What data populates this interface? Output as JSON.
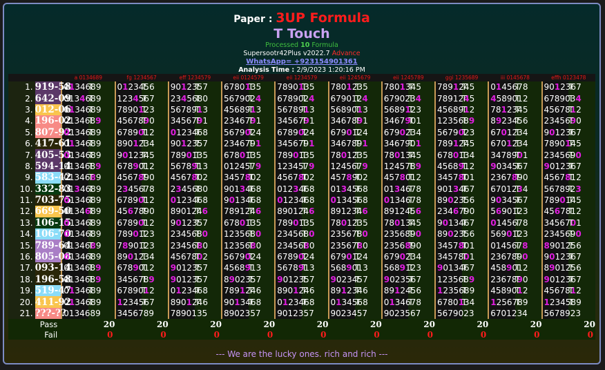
{
  "header": {
    "paper_label": "Paper :",
    "formula_name": "3UP Formula",
    "subtitle": "T Touch",
    "processed_prefix": "Processed",
    "processed_count": "10",
    "processed_suffix": "Formula",
    "version": "Supersootr42Plus v2022.7",
    "edition": "Advance",
    "whatsapp": "WhatsApp= +923154901361",
    "analysis_label": "Analysis Time :",
    "analysis_time": "2/9/2023 1:20:16 PM"
  },
  "colors": {
    "hit": "#e01ee0",
    "purple": "#5b3868",
    "gold": "#f9c54e",
    "pink": "#f78a86",
    "dark": "#2a2608",
    "lightblue": "#8adcf8",
    "darkgreen": "#083a10",
    "lavender": "#a97ec6"
  },
  "columns": [
    "a 0134689",
    "fg 1234567",
    "eff 1234579",
    "eii 0124579",
    "eii 1234579",
    "eii 1245679",
    "eii 1245789",
    "ggi 1235689",
    "iii 0145678",
    "effh 0123478"
  ],
  "status_mark": "T",
  "rows": [
    {
      "n": "1.",
      "result": "919-58",
      "color": "purple",
      "hit": "1",
      "cells": [
        "0134689",
        "0123456",
        "9012357",
        "6780135",
        "7890135",
        "7801235",
        "7801345",
        "7891245",
        "0145678",
        "9012367"
      ]
    },
    {
      "n": "2.",
      "result": "642-09",
      "color": "purple",
      "hit": "4",
      "cells": [
        "0134689",
        "1234567",
        "2345680",
        "5679024",
        "6789024",
        "6790124",
        "6790234",
        "7891245",
        "4589012",
        "6789034"
      ]
    },
    {
      "n": "3.",
      "result": "012-06",
      "color": "gold",
      "hit": "1",
      "cells": [
        "0134689",
        "7890123",
        "5678913",
        "4568913",
        "5678913",
        "5689013",
        "5689123",
        "4568912",
        "7812345",
        "4567812"
      ]
    },
    {
      "n": "4.",
      "result": "196-02",
      "color": "pink",
      "hit": "9",
      "cells": [
        "0134689",
        "4567890",
        "3456791",
        "2346791",
        "3456791",
        "3467891",
        "3467901",
        "1235689",
        "8923456",
        "2345690"
      ]
    },
    {
      "n": "5.",
      "result": "807-92",
      "color": "pink",
      "hit": "0",
      "cells": [
        "0134689",
        "6789012",
        "0123468",
        "5679024",
        "6789024",
        "6790124",
        "6790234",
        "5679023",
        "6701234",
        "9012367"
      ]
    },
    {
      "n": "6.",
      "result": "417-61",
      "color": "dark",
      "hit": "1",
      "cells": [
        "0134689",
        "8901234",
        "9012357",
        "2346791",
        "3456791",
        "3467891",
        "3467901",
        "7891245",
        "6701234",
        "7890145"
      ]
    },
    {
      "n": "7.",
      "result": "405-53",
      "color": "purple",
      "hit": "0",
      "cells": [
        "0134689",
        "9012345",
        "7890135",
        "6780135",
        "7890135",
        "7801235",
        "7801345",
        "6780134",
        "3478901",
        "2345690"
      ]
    },
    {
      "n": "8.",
      "result": "594-14",
      "color": "purple",
      "hit": "9",
      "cells": [
        "0134689",
        "6789012",
        "5678913",
        "0124579",
        "1234579",
        "1245679",
        "1245789",
        "4568912",
        "9034567",
        "9012367"
      ]
    },
    {
      "n": "9.",
      "result": "583-42",
      "color": "lightblue",
      "hit": "8",
      "cells": [
        "0134689",
        "4567890",
        "4567802",
        "3457802",
        "4567802",
        "4578902",
        "4578012",
        "3457801",
        "2367890",
        "4567812"
      ]
    },
    {
      "n": "10.",
      "result": "332-83",
      "color": "darkgreen",
      "hit": "3",
      "cells": [
        "0134689",
        "2345678",
        "2345680",
        "9013468",
        "0123468",
        "0134568",
        "0134678",
        "9013467",
        "6701234",
        "5678923"
      ]
    },
    {
      "n": "11.",
      "result": "703-75",
      "color": "dark",
      "hit": "0",
      "cells": [
        "0134689",
        "6789012",
        "0123468",
        "9013468",
        "0123468",
        "0134568",
        "0134678",
        "8902356",
        "9034567",
        "7890145"
      ]
    },
    {
      "n": "12.",
      "result": "669-50",
      "color": "gold",
      "hit": "6",
      "cells": [
        "0134689",
        "4567890",
        "8901246",
        "7891246",
        "8901246",
        "8912346",
        "8912456",
        "2346790",
        "5690123",
        "4567812"
      ]
    },
    {
      "n": "13.",
      "result": "106-15",
      "color": "darkgreen",
      "hit": "0",
      "cells": [
        "0134689",
        "6789012",
        "9012357",
        "6780135",
        "7890135",
        "7801235",
        "7801345",
        "9013467",
        "0145678",
        "3456701"
      ]
    },
    {
      "n": "14.",
      "result": "106-70",
      "color": "lightblue",
      "hit": "0",
      "cells": [
        "0134689",
        "7890123",
        "2345680",
        "1235680",
        "2345680",
        "2356780",
        "2356890",
        "8902356",
        "5690123",
        "2345690"
      ]
    },
    {
      "n": "15.",
      "result": "789-64",
      "color": "lavender",
      "hit": "8",
      "cells": [
        "0134689",
        "7890123",
        "2345680",
        "1235680",
        "2345680",
        "2356780",
        "2356890",
        "3457801",
        "0145678",
        "8901256"
      ]
    },
    {
      "n": "16.",
      "result": "805-08",
      "color": "lavender",
      "hit": "0",
      "cells": [
        "0134689",
        "8901234",
        "4567802",
        "5679024",
        "6789024",
        "6790124",
        "6790234",
        "3457801",
        "2367890",
        "9012367"
      ]
    },
    {
      "n": "17.",
      "result": "093-14",
      "color": "dark",
      "hit": "9",
      "cells": [
        "0134689",
        "6789012",
        "9012357",
        "4568913",
        "5678913",
        "5689013",
        "5689123",
        "9013467",
        "4589012",
        "8901256"
      ]
    },
    {
      "n": "18.",
      "result": "196-58",
      "color": "dark",
      "hit": "9",
      "cells": [
        "0134689",
        "3456789",
        "9012357",
        "8902357",
        "9012357",
        "9023457",
        "9023567",
        "1235689",
        "2367890",
        "9012367"
      ]
    },
    {
      "n": "19.",
      "result": "519-47",
      "color": "lightblue",
      "hit": "1",
      "cells": [
        "0134689",
        "6789012",
        "0123468",
        "7891246",
        "8901246",
        "8912346",
        "8912456",
        "1235689",
        "4589012",
        "4567812"
      ]
    },
    {
      "n": "20.",
      "result": "411-92",
      "color": "gold",
      "hit": "1",
      "cells": [
        "0134689",
        "1234567",
        "8901246",
        "9013468",
        "0123468",
        "0134568",
        "0134678",
        "6780134",
        "1256789",
        "1234589"
      ]
    },
    {
      "n": "21.",
      "result": "???-??",
      "color": "pink",
      "hit": "",
      "cells": [
        "0134689",
        "3456789",
        "7890135",
        "8902357",
        "9012357",
        "9023457",
        "9023567",
        "5679023",
        "6701234",
        "5678923"
      ]
    }
  ],
  "summary": {
    "pass_label": "Pass",
    "fail_label": "Fail",
    "pass": [
      "20",
      "20",
      "20",
      "20",
      "20",
      "20",
      "20",
      "20",
      "20",
      "20"
    ],
    "fail": [
      "0",
      "0",
      "0",
      "0",
      "0",
      "0",
      "0",
      "0",
      "0",
      "0"
    ]
  },
  "footer": "--- We are the lucky ones. rich and rich ---"
}
